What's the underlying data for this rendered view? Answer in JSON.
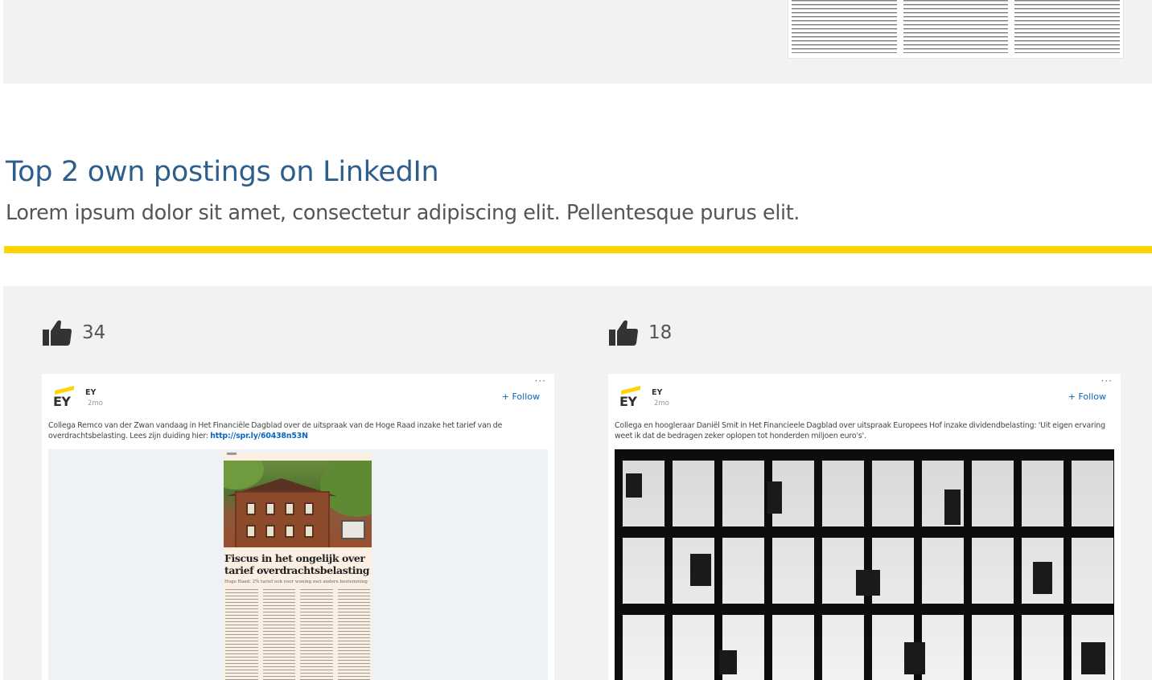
{
  "section": {
    "title": "Top 2 own postings on LinkedIn",
    "subtitle": "Lorem ipsum dolor sit amet, consectetur adipiscing elit. Pellentesque purus elit."
  },
  "colors": {
    "title": "#2e5e8c",
    "accent_bar": "#ffd400",
    "panel_bg": "#f2f2f2",
    "link": "#0a66c2"
  },
  "posts": [
    {
      "likes": "34",
      "like_icon": "thumbs-up-icon",
      "author": "EY",
      "logo_text": "EY",
      "time": "2mo",
      "more": "···",
      "follow": "+ Follow",
      "text": "Collega Remco van der Zwan vandaag in Het Financiële Dagblad over de uitspraak van de Hoge Raad inzake het tarief van de overdrachtsbelasting. Lees zijn duiding hier: ",
      "link": "http://spr.ly/60438n53N",
      "media_headline": "Fiscus in het ongelijk over tarief overdrachtsbelasting",
      "media_deck": "Hoge Raad: 2% tarief ook voor woning met andere bestemming"
    },
    {
      "likes": "18",
      "like_icon": "thumbs-up-icon",
      "author": "EY",
      "logo_text": "EY",
      "time": "2mo",
      "more": "···",
      "follow": "+ Follow",
      "text": "Collega en hoogleraar Daniël Smit in Het Financieele Dagblad over uitspraak Europees Hof inzake dividendbelasting: 'Uit eigen ervaring weet ik dat de bedragen zeker oplopen tot honderden miljoen euro's'."
    }
  ]
}
